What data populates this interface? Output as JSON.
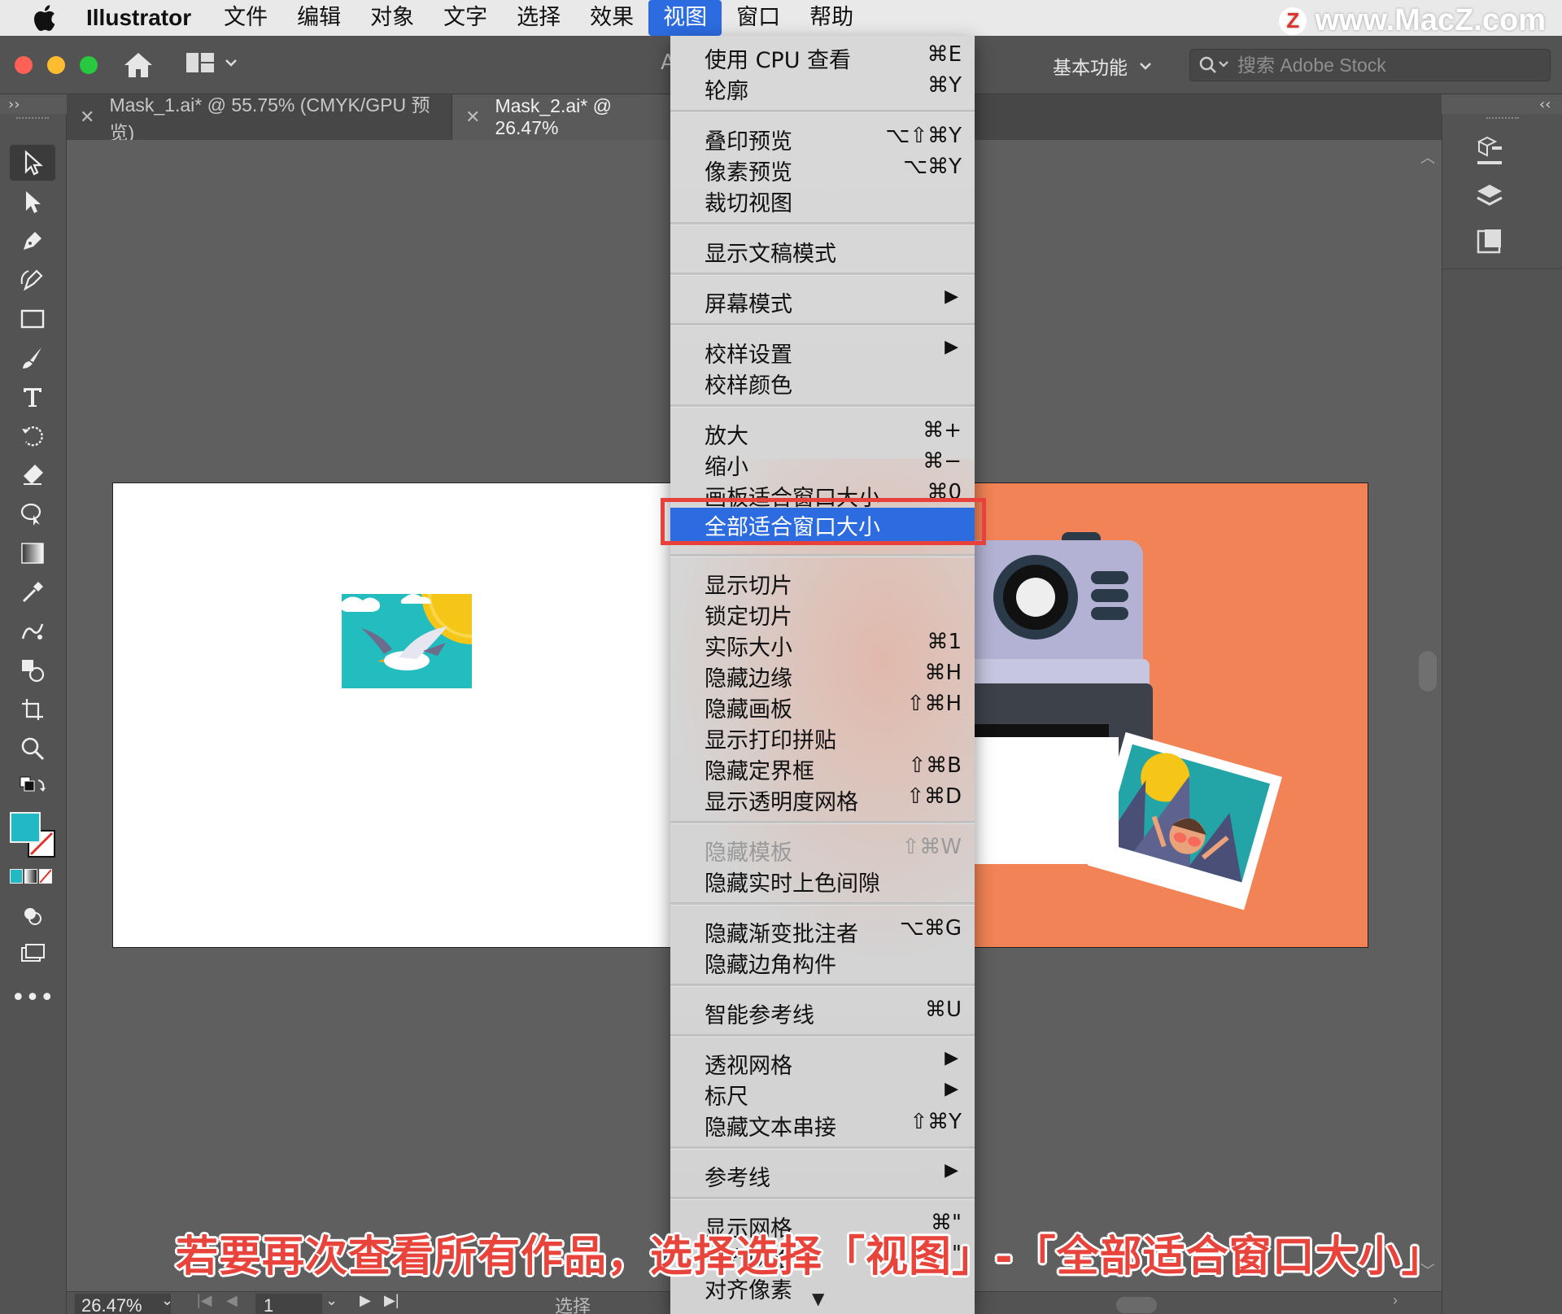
{
  "menubar": {
    "app_name": "Illustrator",
    "menus": [
      "文件",
      "编辑",
      "对象",
      "文字",
      "选择",
      "效果",
      "视图",
      "窗口",
      "帮助"
    ],
    "active_menu": "视图"
  },
  "watermark": "www.MacZ.com",
  "watermark_logo": "Z",
  "appbar": {
    "title_fragment": "A",
    "workspace": "基本功能",
    "search_placeholder": "搜索 Adobe Stock"
  },
  "tabs": [
    {
      "label": "Mask_1.ai* @ 55.75% (CMYK/GPU 预览)",
      "active": false
    },
    {
      "label": "Mask_2.ai* @ 26.47%",
      "active": true
    }
  ],
  "view_menu": {
    "items": [
      {
        "label": "使用 CPU 查看",
        "shortcut": "⌘E"
      },
      {
        "label": "轮廓",
        "shortcut": "⌘Y"
      },
      {
        "separator": true
      },
      {
        "label": "叠印预览",
        "shortcut": "⌥⇧⌘Y"
      },
      {
        "label": "像素预览",
        "shortcut": "⌥⌘Y"
      },
      {
        "label": "裁切视图",
        "shortcut": ""
      },
      {
        "separator": true
      },
      {
        "label": "显示文稿模式",
        "shortcut": ""
      },
      {
        "separator": true
      },
      {
        "label": "屏幕模式",
        "submenu": true
      },
      {
        "separator": true
      },
      {
        "label": "校样设置",
        "submenu": true
      },
      {
        "label": "校样颜色",
        "shortcut": ""
      },
      {
        "separator": true
      },
      {
        "label": "放大",
        "shortcut": "⌘+"
      },
      {
        "label": "缩小",
        "shortcut": "⌘−"
      },
      {
        "label": "画板适合窗口大小",
        "shortcut": "⌘0"
      },
      {
        "label": "全部适合窗口大小",
        "shortcut": "",
        "highlighted": true
      },
      {
        "separator": true
      },
      {
        "label": "显示切片",
        "shortcut": ""
      },
      {
        "label": "锁定切片",
        "shortcut": ""
      },
      {
        "label": "实际大小",
        "shortcut": "⌘1"
      },
      {
        "label": "隐藏边缘",
        "shortcut": "⌘H"
      },
      {
        "label": "隐藏画板",
        "shortcut": "⇧⌘H"
      },
      {
        "label": "显示打印拼贴",
        "shortcut": ""
      },
      {
        "label": "隐藏定界框",
        "shortcut": "⇧⌘B"
      },
      {
        "label": "显示透明度网格",
        "shortcut": "⇧⌘D"
      },
      {
        "separator": true
      },
      {
        "label": "隐藏模板",
        "shortcut": "⇧⌘W",
        "disabled": true
      },
      {
        "label": "隐藏实时上色间隙",
        "shortcut": ""
      },
      {
        "separator": true
      },
      {
        "label": "隐藏渐变批注者",
        "shortcut": "⌥⌘G"
      },
      {
        "label": "隐藏边角构件",
        "shortcut": ""
      },
      {
        "separator": true
      },
      {
        "label": "智能参考线",
        "shortcut": "⌘U"
      },
      {
        "separator": true
      },
      {
        "label": "透视网格",
        "submenu": true
      },
      {
        "label": "标尺",
        "submenu": true
      },
      {
        "label": "隐藏文本串接",
        "shortcut": "⇧⌘Y"
      },
      {
        "separator": true
      },
      {
        "label": "参考线",
        "submenu": true
      },
      {
        "separator": true
      },
      {
        "label": "显示网格",
        "shortcut": "⌘\""
      },
      {
        "label": "对齐网格",
        "shortcut": "⇧⌘\""
      },
      {
        "label": "对齐像素",
        "shortcut": ""
      }
    ]
  },
  "statusbar": {
    "zoom": "26.47%",
    "page": "1",
    "mode": "选择"
  },
  "caption": "若要再次查看所有作品，选择选择「视图」-「全部适合窗口大小」",
  "colors": {
    "menu_highlight": "#2c6ce0",
    "callout_border": "#e8413c",
    "caption_text": "#e8443b",
    "artboard_orange": "#f18356",
    "fill_swatch": "#22b8c4",
    "illustration_teal": "#23bcbf",
    "illustration_sun": "#f5c518",
    "camera_body": "#b3b2d4"
  }
}
